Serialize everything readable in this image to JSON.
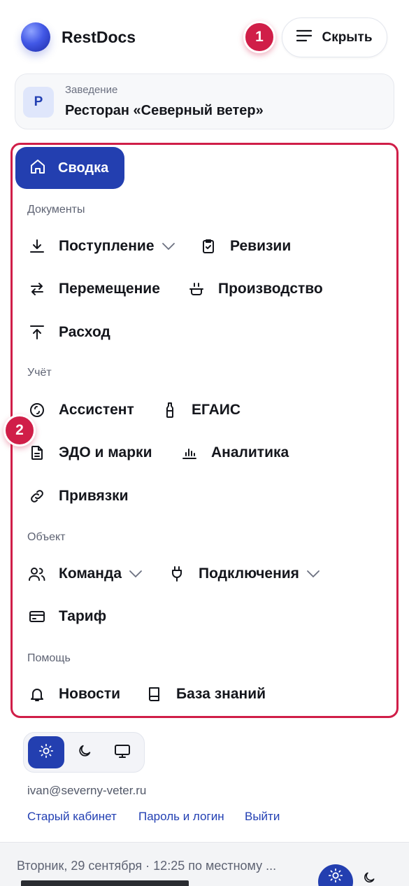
{
  "header": {
    "brand": "RestDocs",
    "hide_label": "Скрыть",
    "annotation_1": "1"
  },
  "venue": {
    "caption": "Заведение",
    "avatar_letter": "Р",
    "name": "Ресторан «Северный ветер»"
  },
  "annotation_2": "2",
  "nav": {
    "active": "Сводка",
    "sections": {
      "documents": "Документы",
      "accounting": "Учёт",
      "object": "Объект",
      "help": "Помощь"
    },
    "items": {
      "receipt": "Поступление",
      "audits": "Ревизии",
      "transfer": "Перемещение",
      "production": "Производство",
      "expense": "Расход",
      "assistant": "Ассистент",
      "egais": "ЕГАИС",
      "edo": "ЭДО и марки",
      "analytics": "Аналитика",
      "bindings": "Привязки",
      "team": "Команда",
      "connections": "Подключения",
      "tariff": "Тариф",
      "news": "Новости",
      "kb": "База знаний"
    }
  },
  "account": {
    "email": "ivan@severny-veter.ru",
    "links": [
      "Старый кабинет",
      "Пароль и логин",
      "Выйти"
    ]
  },
  "footer": {
    "datetime": "Вторник, 29 сентября · 12:25 по местному ..."
  },
  "colors": {
    "accent": "#233fb0",
    "highlight": "#d01e48"
  }
}
